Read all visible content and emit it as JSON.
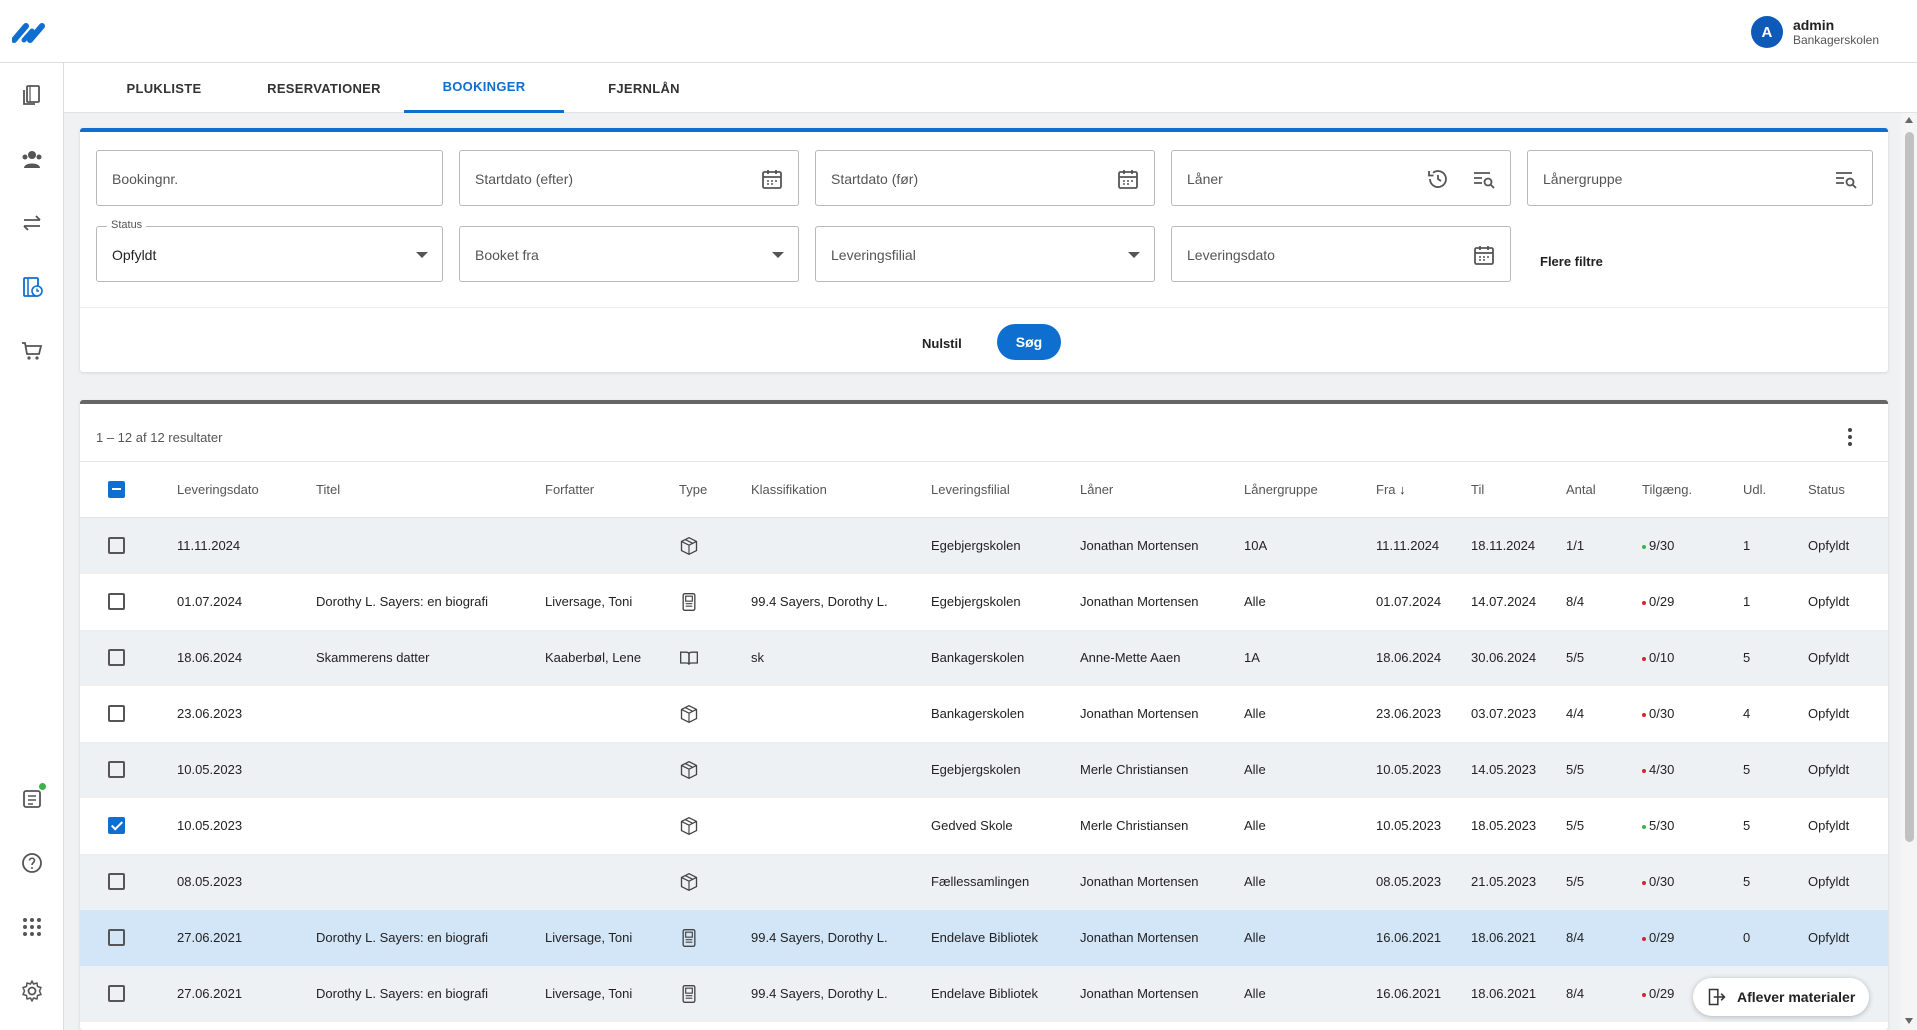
{
  "user": {
    "initial": "A",
    "name": "admin",
    "school": "Bankagerskolen"
  },
  "tabs": [
    "PLUKLISTE",
    "RESERVATIONER",
    "BOOKINGER",
    "FJERNLÅN"
  ],
  "active_tab": "BOOKINGER",
  "filters": {
    "bookingnr": "Bookingnr.",
    "startdato_efter": "Startdato (efter)",
    "startdato_foer": "Startdato (før)",
    "laaner": "Låner",
    "laanergruppe": "Lånergruppe",
    "status_label": "Status",
    "status_value": "Opfyldt",
    "booket_fra": "Booket fra",
    "leveringsfilial": "Leveringsfilial",
    "leveringsdato": "Leveringsdato",
    "flere_filtre": "Flere filtre",
    "reset": "Nulstil",
    "search": "Søg"
  },
  "results": {
    "count_text": "1 – 12 af 12 resultater",
    "columns": [
      "Leveringsdato",
      "Titel",
      "Forfatter",
      "Type",
      "Klassifikation",
      "Leveringsfilial",
      "Låner",
      "Lånergruppe",
      "Fra",
      "Til",
      "Antal",
      "Tilgæng.",
      "Udl.",
      "Status"
    ],
    "rows": [
      {
        "checked": false,
        "leveringsdato": "11.11.2024",
        "titel": "",
        "forfatter": "",
        "type": "box-icon",
        "klassifikation": "",
        "leveringsfilial": "Egebjergskolen",
        "laaner": "Jonathan Mortensen",
        "laanergruppe": "10A",
        "fra": "11.11.2024",
        "til": "18.11.2024",
        "antal": "1/1",
        "tilgaeng": "9/30",
        "tilgaeng_color": "#3ab34a",
        "udl": "1",
        "status": "Opfyldt"
      },
      {
        "checked": false,
        "leveringsdato": "01.07.2024",
        "titel": "Dorothy L. Sayers: en biografi",
        "forfatter": "Liversage, Toni",
        "type": "ebook-icon",
        "klassifikation": "99.4 Sayers, Dorothy L.",
        "leveringsfilial": "Egebjergskolen",
        "laaner": "Jonathan Mortensen",
        "laanergruppe": "Alle",
        "fra": "01.07.2024",
        "til": "14.07.2024",
        "antal": "8/4",
        "tilgaeng": "0/29",
        "tilgaeng_color": "#d9232e",
        "udl": "1",
        "status": "Opfyldt"
      },
      {
        "checked": false,
        "leveringsdato": "18.06.2024",
        "titel": "Skammerens datter",
        "forfatter": "Kaaberbøl, Lene",
        "type": "book-icon",
        "klassifikation": "sk",
        "leveringsfilial": "Bankagerskolen",
        "laaner": "Anne-Mette Aaen",
        "laanergruppe": "1A",
        "fra": "18.06.2024",
        "til": "30.06.2024",
        "antal": "5/5",
        "tilgaeng": "0/10",
        "tilgaeng_color": "#d9232e",
        "udl": "5",
        "status": "Opfyldt"
      },
      {
        "checked": false,
        "leveringsdato": "23.06.2023",
        "titel": "",
        "forfatter": "",
        "type": "box-icon",
        "klassifikation": "",
        "leveringsfilial": "Bankagerskolen",
        "laaner": "Jonathan Mortensen",
        "laanergruppe": "Alle",
        "fra": "23.06.2023",
        "til": "03.07.2023",
        "antal": "4/4",
        "tilgaeng": "0/30",
        "tilgaeng_color": "#d9232e",
        "udl": "4",
        "status": "Opfyldt"
      },
      {
        "checked": false,
        "leveringsdato": "10.05.2023",
        "titel": "",
        "forfatter": "",
        "type": "box-icon",
        "klassifikation": "",
        "leveringsfilial": "Egebjergskolen",
        "laaner": "Merle Christiansen",
        "laanergruppe": "Alle",
        "fra": "10.05.2023",
        "til": "14.05.2023",
        "antal": "5/5",
        "tilgaeng": "4/30",
        "tilgaeng_color": "#d9232e",
        "udl": "5",
        "status": "Opfyldt"
      },
      {
        "checked": true,
        "leveringsdato": "10.05.2023",
        "titel": "",
        "forfatter": "",
        "type": "box-icon",
        "klassifikation": "",
        "leveringsfilial": "Gedved Skole",
        "laaner": "Merle Christiansen",
        "laanergruppe": "Alle",
        "fra": "10.05.2023",
        "til": "18.05.2023",
        "antal": "5/5",
        "tilgaeng": "5/30",
        "tilgaeng_color": "#3ab34a",
        "udl": "5",
        "status": "Opfyldt"
      },
      {
        "checked": false,
        "leveringsdato": "08.05.2023",
        "titel": "",
        "forfatter": "",
        "type": "box-icon",
        "klassifikation": "",
        "leveringsfilial": "Fællessamlingen",
        "laaner": "Jonathan Mortensen",
        "laanergruppe": "Alle",
        "fra": "08.05.2023",
        "til": "21.05.2023",
        "antal": "5/5",
        "tilgaeng": "0/30",
        "tilgaeng_color": "#d9232e",
        "udl": "5",
        "status": "Opfyldt"
      },
      {
        "checked": false,
        "leveringsdato": "27.06.2021",
        "titel": "Dorothy L. Sayers: en biografi",
        "forfatter": "Liversage, Toni",
        "type": "ebook-icon",
        "klassifikation": "99.4 Sayers, Dorothy L.",
        "leveringsfilial": "Endelave Bibliotek",
        "laaner": "Jonathan Mortensen",
        "laanergruppe": "Alle",
        "fra": "16.06.2021",
        "til": "18.06.2021",
        "antal": "8/4",
        "tilgaeng": "0/29",
        "tilgaeng_color": "#d9232e",
        "udl": "0",
        "status": "Opfyldt"
      },
      {
        "checked": false,
        "leveringsdato": "27.06.2021",
        "titel": "Dorothy L. Sayers: en biografi",
        "forfatter": "Liversage, Toni",
        "type": "ebook-icon",
        "klassifikation": "99.4 Sayers, Dorothy L.",
        "leveringsfilial": "Endelave Bibliotek",
        "laaner": "Jonathan Mortensen",
        "laanergruppe": "Alle",
        "fra": "16.06.2021",
        "til": "18.06.2021",
        "antal": "8/4",
        "tilgaeng": "0/29",
        "tilgaeng_color": "#d9232e",
        "udl": "",
        "status": ""
      }
    ]
  },
  "fab_label": "Aflever materialer",
  "colors": {
    "accent": "#0e6fd0",
    "selected_row": "#d3e6f8",
    "available": "#3ab34a",
    "unavailable": "#d9232e"
  }
}
